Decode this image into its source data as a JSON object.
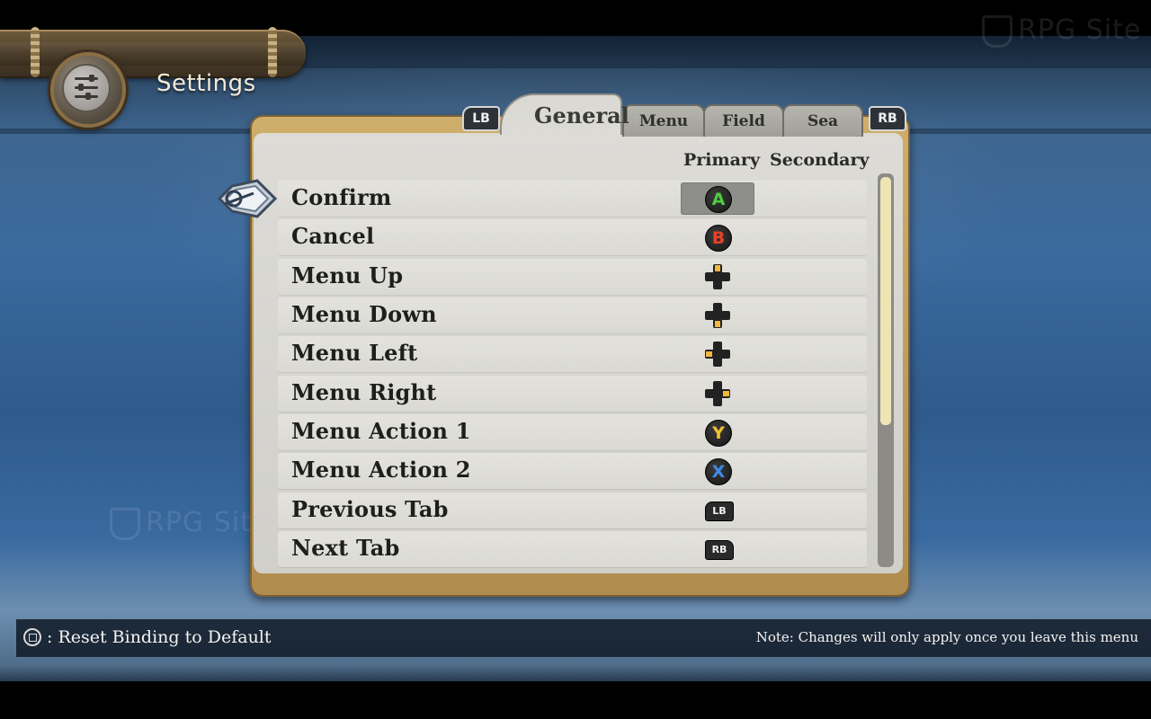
{
  "header": {
    "title": "Settings",
    "icon": "settings-sliders-icon"
  },
  "watermark": {
    "text": "RPG Site"
  },
  "tabs": {
    "prev_shoulder": "LB",
    "next_shoulder": "RB",
    "items": [
      {
        "label": "General",
        "active": true
      },
      {
        "label": "Menu",
        "active": false
      },
      {
        "label": "Field",
        "active": false
      },
      {
        "label": "Sea",
        "active": false
      }
    ]
  },
  "columns": {
    "primary": "Primary",
    "secondary": "Secondary"
  },
  "bindings": [
    {
      "action": "Confirm",
      "primary": "A",
      "primary_icon": "a-button-icon",
      "primary_color": "#4ccf3f",
      "secondary": "",
      "selected": true
    },
    {
      "action": "Cancel",
      "primary": "B",
      "primary_icon": "b-button-icon",
      "primary_color": "#e8402a",
      "secondary": ""
    },
    {
      "action": "Menu Up",
      "primary": "",
      "primary_icon": "dpad-up-icon",
      "secondary": ""
    },
    {
      "action": "Menu Down",
      "primary": "",
      "primary_icon": "dpad-down-icon",
      "secondary": ""
    },
    {
      "action": "Menu Left",
      "primary": "",
      "primary_icon": "dpad-left-icon",
      "secondary": ""
    },
    {
      "action": "Menu Right",
      "primary": "",
      "primary_icon": "dpad-right-icon",
      "secondary": ""
    },
    {
      "action": "Menu Action 1",
      "primary": "Y",
      "primary_icon": "y-button-icon",
      "primary_color": "#f2c02b",
      "secondary": ""
    },
    {
      "action": "Menu Action 2",
      "primary": "X",
      "primary_icon": "x-button-icon",
      "primary_color": "#3d8ce8",
      "secondary": ""
    },
    {
      "action": "Previous Tab",
      "primary": "LB",
      "primary_icon": "lb-bumper-icon",
      "secondary": ""
    },
    {
      "action": "Next Tab",
      "primary": "RB",
      "primary_icon": "rb-bumper-icon",
      "secondary": ""
    }
  ],
  "scrollbar": {
    "position": 0,
    "visible_fraction": 0.63
  },
  "footer": {
    "reset_label": ": Reset Binding to Default",
    "reset_icon": "view-button-icon",
    "note": "Note: Changes will only apply once you leave this menu"
  },
  "colors": {
    "dpad_highlight": "#f1b83a",
    "frame_gold": "#c6a564",
    "panel_bg": "#d9d8d3",
    "scroll_thumb": "#efe5b4"
  }
}
